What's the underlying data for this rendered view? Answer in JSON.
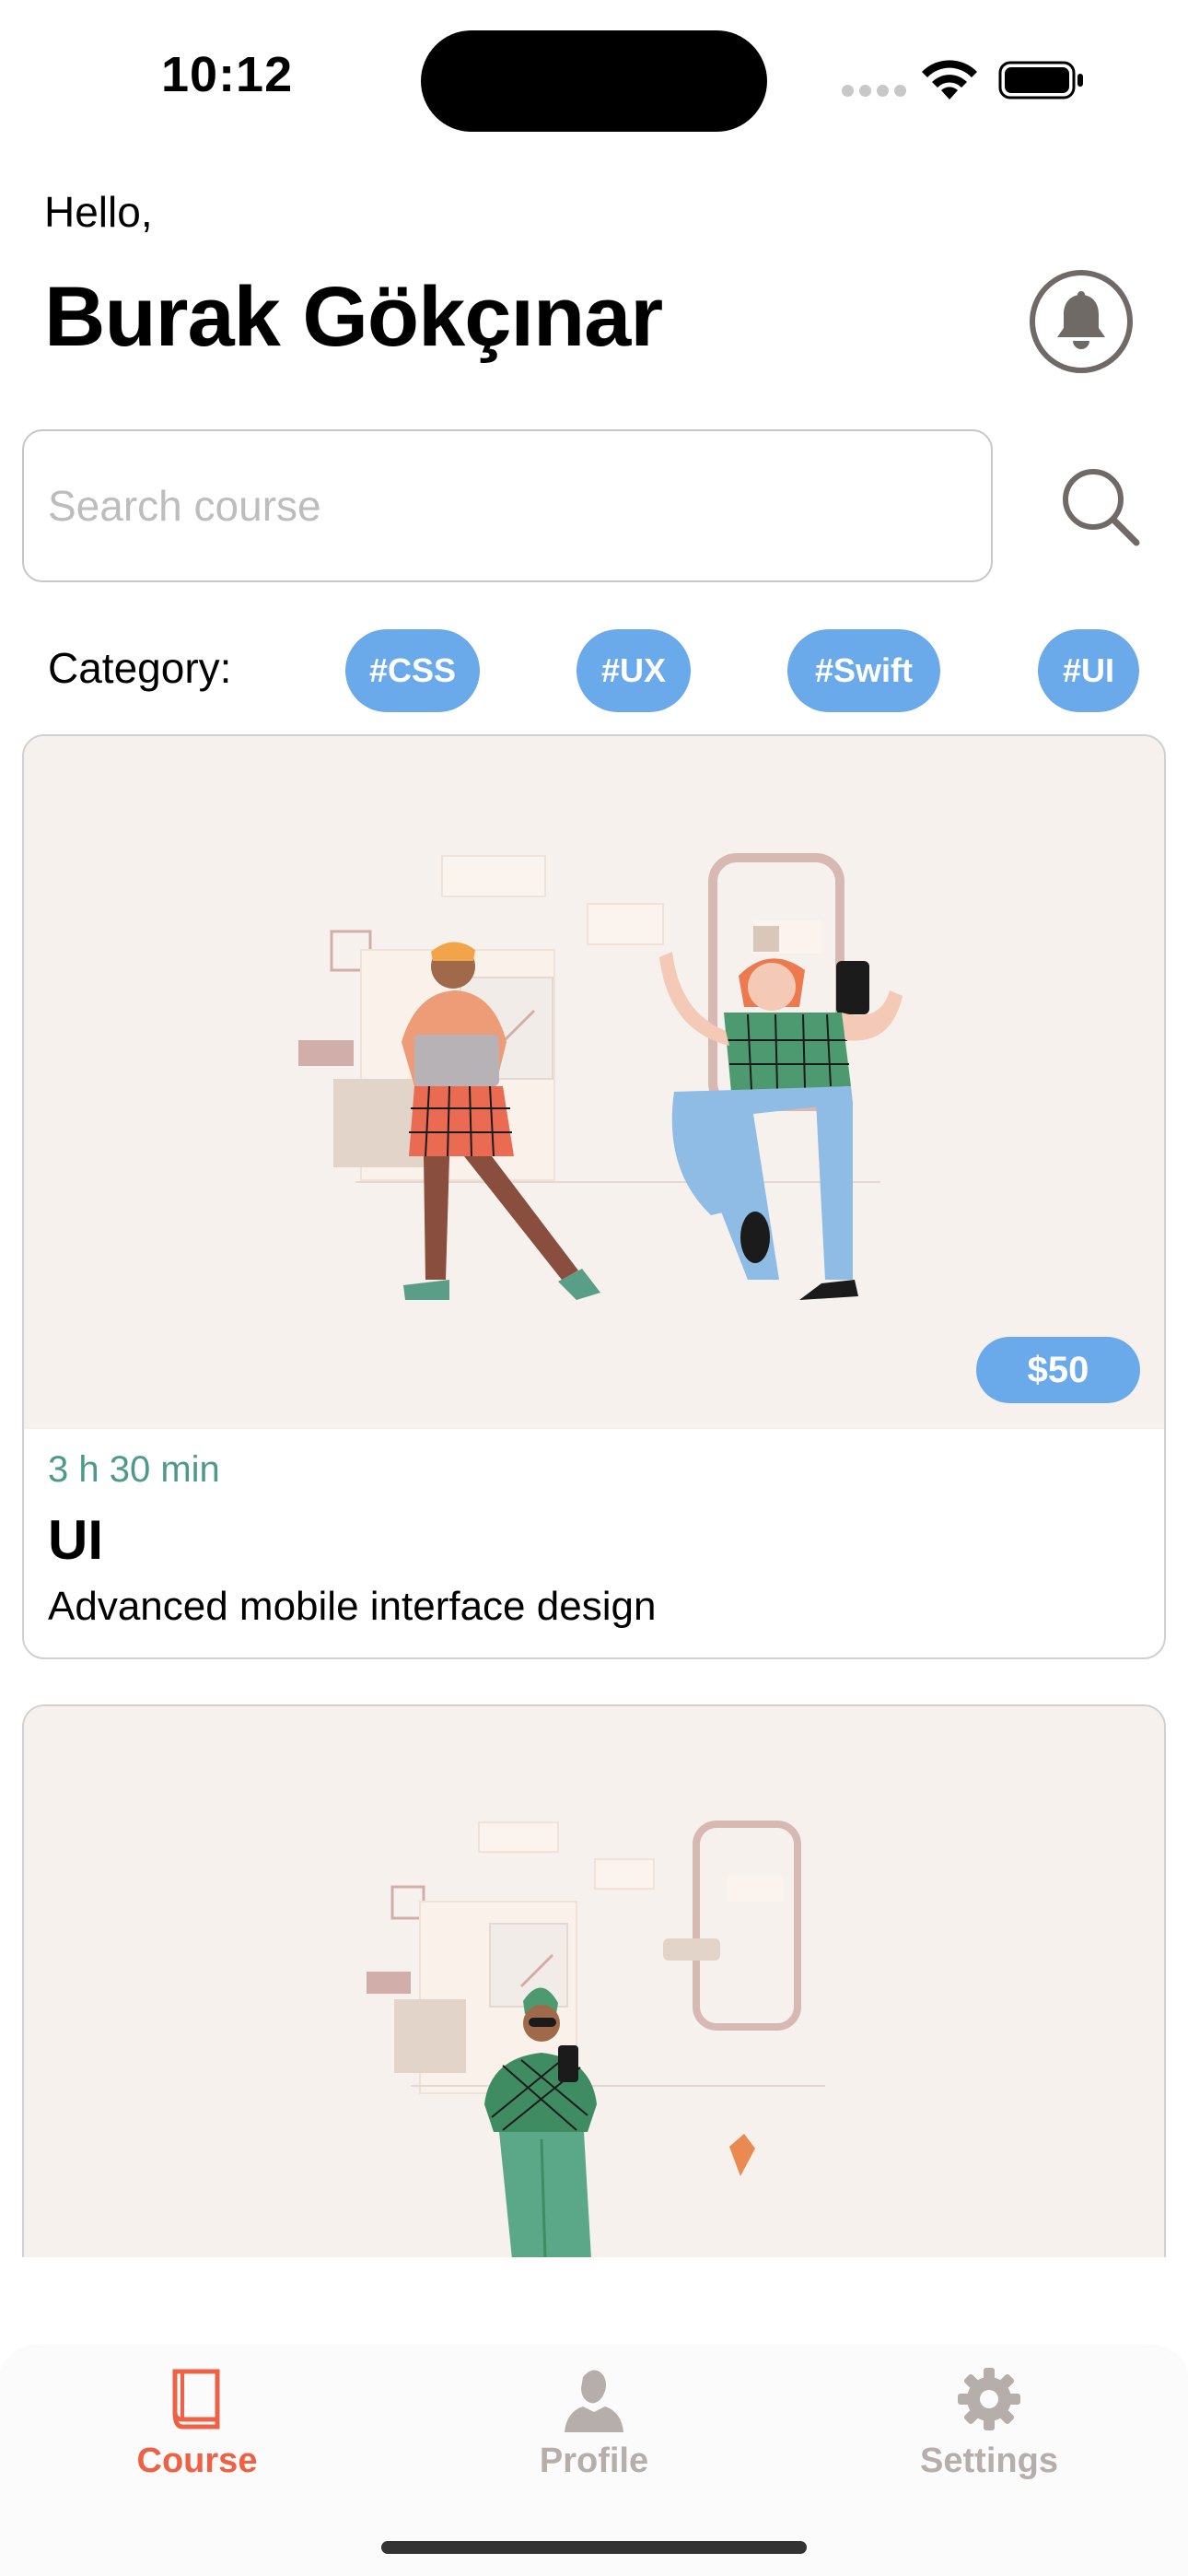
{
  "status_bar": {
    "time": "10:12"
  },
  "header": {
    "greeting": "Hello,",
    "user_name": "Burak Gökçınar"
  },
  "search": {
    "placeholder": "Search course",
    "value": ""
  },
  "categories": {
    "label": "Category:",
    "chips": [
      "#CSS",
      "#UX",
      "#Swift",
      "#UI"
    ]
  },
  "courses": [
    {
      "duration": "3 h 30 min",
      "title": "UI",
      "description": "Advanced mobile interface design",
      "price": "$50",
      "image_icon": "two-people-design-illustration"
    },
    {
      "image_icon": "person-with-phone-illustration"
    }
  ],
  "tab_bar": {
    "items": [
      {
        "label": "Course",
        "icon": "book-icon",
        "active": true
      },
      {
        "label": "Profile",
        "icon": "person-icon",
        "active": false
      },
      {
        "label": "Settings",
        "icon": "gear-icon",
        "active": false
      }
    ]
  },
  "colors": {
    "accent_chip": "#6aaaea",
    "tab_active": "#ef6145",
    "tab_inactive": "#b5aeaa",
    "duration_text": "#4e9a8a",
    "card_image_bg": "#f6f1ed"
  }
}
